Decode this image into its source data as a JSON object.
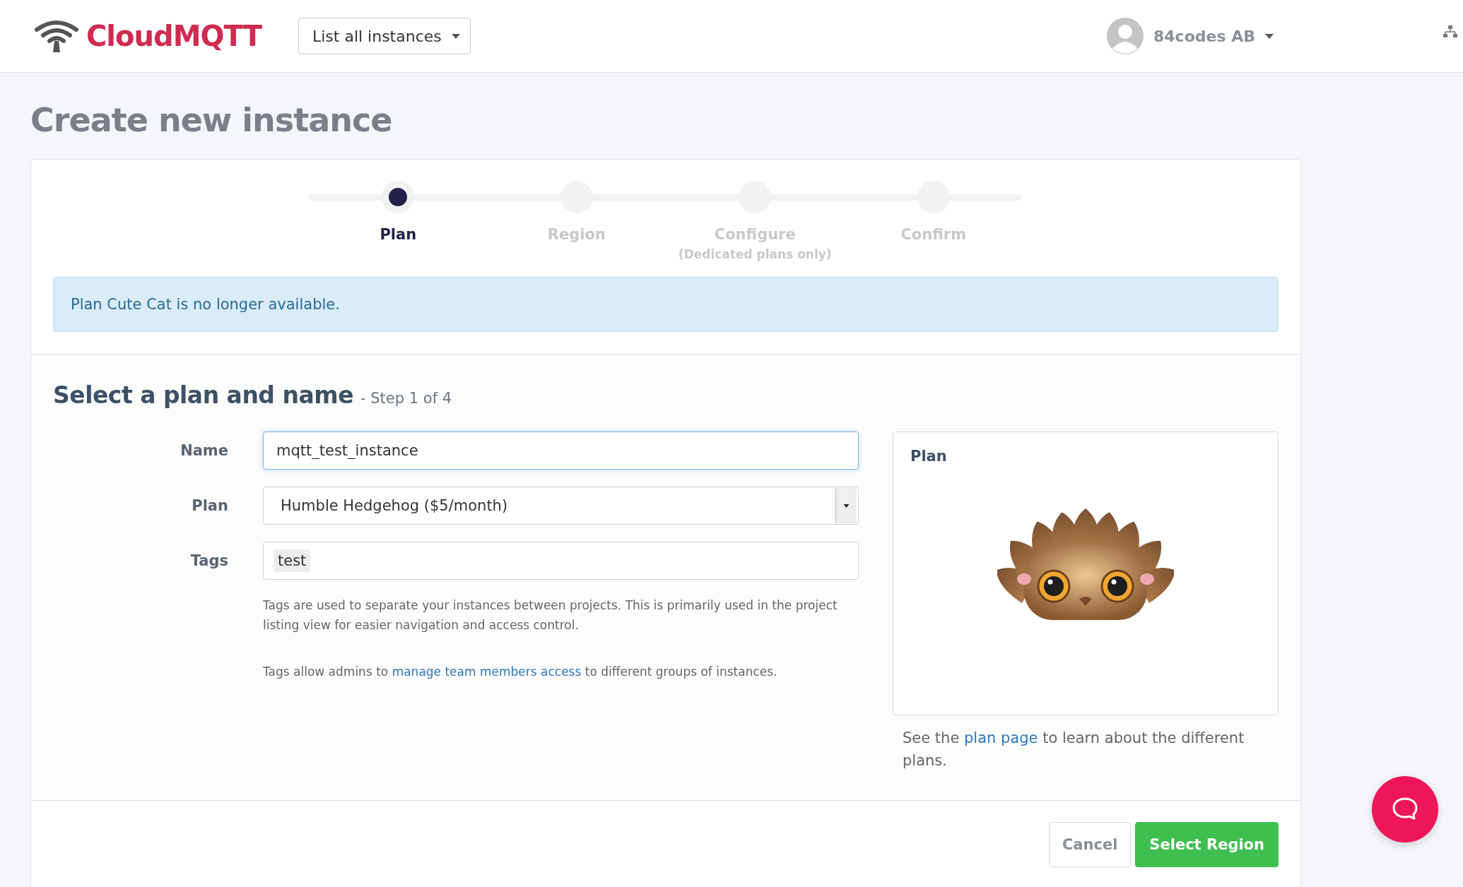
{
  "header": {
    "logo": "CloudMQTT",
    "instances_menu": "List all instances",
    "account": "84codes AB"
  },
  "page_title": "Create new instance",
  "steps": [
    {
      "label": "Plan",
      "selected": true
    },
    {
      "label": "Region",
      "selected": false
    },
    {
      "label": "Configure",
      "note": "(Dedicated plans only)",
      "selected": false
    },
    {
      "label": "Confirm",
      "selected": false
    }
  ],
  "alert": "Plan Cute Cat is no longer available.",
  "section": {
    "title": "Select a plan and name",
    "step": "- Step 1 of 4"
  },
  "form": {
    "name_label": "Name",
    "name_value": "mqtt_test_instance",
    "plan_label": "Plan",
    "plan_value": "Humble Hedgehog ($5/month)",
    "tags_label": "Tags",
    "tags": [
      "test"
    ],
    "help_1": "Tags are used to separate your instances between projects. This is primarily used in the project listing view for easier navigation and access control.",
    "help_2_before": "Tags allow admins to",
    "help_2_link": "manage team members access",
    "help_2_after": "to different groups of instances."
  },
  "plan_panel": {
    "title": "Plan",
    "caption_before": "See the",
    "caption_link": "plan page",
    "caption_after": "to learn about the different plans."
  },
  "buttons": {
    "cancel": "Cancel",
    "next": "Select Region"
  }
}
